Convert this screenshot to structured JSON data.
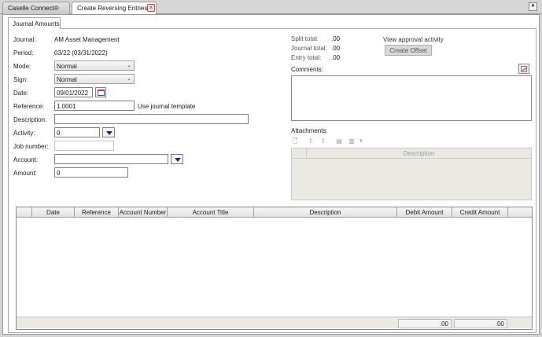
{
  "tabs": [
    {
      "label": "Caselle Connect®"
    },
    {
      "label": "Create Reversing Entries"
    }
  ],
  "subtab": {
    "label": "Journal Amounts"
  },
  "form": {
    "journal_label": "Journal:",
    "journal_value": "AM Asset Management",
    "period_label": "Period:",
    "period_value": "03/22 (03/31/2022)",
    "mode_label": "Mode:",
    "mode_value": "Normal",
    "sign_label": "Sign:",
    "sign_value": "Normal",
    "date_label": "Date:",
    "date_value": "09/01/2022",
    "reference_label": "Reference:",
    "reference_value": "1.0001",
    "use_template": "Use journal template",
    "description_label": "Description:",
    "description_value": "",
    "activity_label": "Activity:",
    "activity_value": "0",
    "job_label": "Job number:",
    "job_value": "",
    "account_label": "Account:",
    "account_value": "",
    "amount_label": "Amount:",
    "amount_value": "0"
  },
  "totals": {
    "split_label": "Split total:",
    "split_value": ".00",
    "journal_label": "Journal total:",
    "journal_value": ".00",
    "entry_label": "Entry total:",
    "entry_value": ".00"
  },
  "approval": {
    "link": "View approval activity",
    "offset_button": "Create Offset"
  },
  "comments": {
    "label": "Comments:"
  },
  "attachments": {
    "label": "Attachments:",
    "column": "Description"
  },
  "grid": {
    "columns": [
      "",
      "Date",
      "Reference",
      "Account Number",
      "Account Title",
      "Description",
      "Debit Amount",
      "Credit Amount",
      ""
    ],
    "debit_total": ".00",
    "credit_total": ".00"
  }
}
